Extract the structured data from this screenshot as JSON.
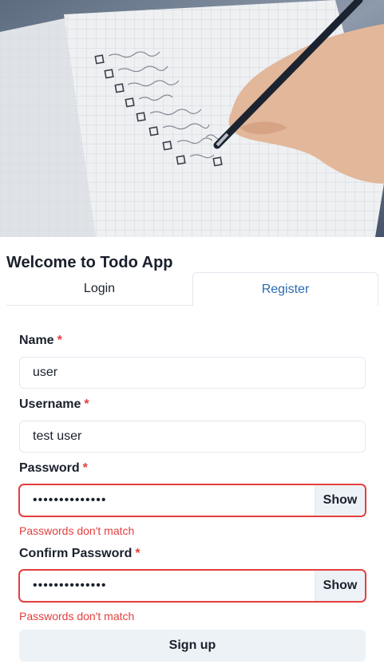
{
  "hero": {
    "image": "notebook-checklist-photo"
  },
  "title": "Welcome to Todo App",
  "tabs": [
    {
      "label": "Login",
      "active": false
    },
    {
      "label": "Register",
      "active": true
    }
  ],
  "form": {
    "name": {
      "label": "Name",
      "required_mark": "*",
      "value": "user"
    },
    "username": {
      "label": "Username",
      "required_mark": "*",
      "value": "test user"
    },
    "password": {
      "label": "Password",
      "required_mark": "*",
      "value": "••••••••••••••",
      "toggle_label": "Show",
      "error": "Passwords don't match"
    },
    "confirm_password": {
      "label": "Confirm Password",
      "required_mark": "*",
      "value": "••••••••••••••",
      "toggle_label": "Show",
      "error": "Passwords don't match"
    },
    "submit_label": "Sign up"
  },
  "colors": {
    "accent": "#2b6cb0",
    "error": "#e53e3e",
    "button_bg": "#edf2f7",
    "border": "#e2e8f0"
  }
}
